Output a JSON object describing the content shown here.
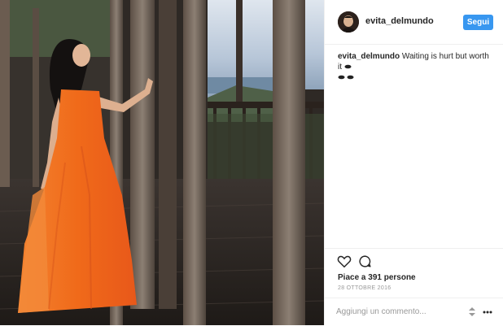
{
  "post": {
    "photo_description_icon": "photo",
    "header": {
      "username": "evita_delmundo",
      "follow_label": "Segui",
      "avatar_icon": "avatar"
    },
    "caption": {
      "username": "evita_delmundo",
      "text": "Waiting is hurt but worth it",
      "emoji_icon": "leaf-emoji"
    },
    "actions": {
      "like_icon": "heart-icon",
      "comment_icon": "comment-icon"
    },
    "likes_text": "Piace a 391 persone",
    "date_text": "28 OTTOBRE 2016",
    "comment_box": {
      "placeholder": "Aggiungi un commento...",
      "sort_icon": "sort-icon",
      "more_icon": "more-icon"
    },
    "colors": {
      "follow_button": "#3897f0",
      "dress": "#f06a1a"
    }
  }
}
